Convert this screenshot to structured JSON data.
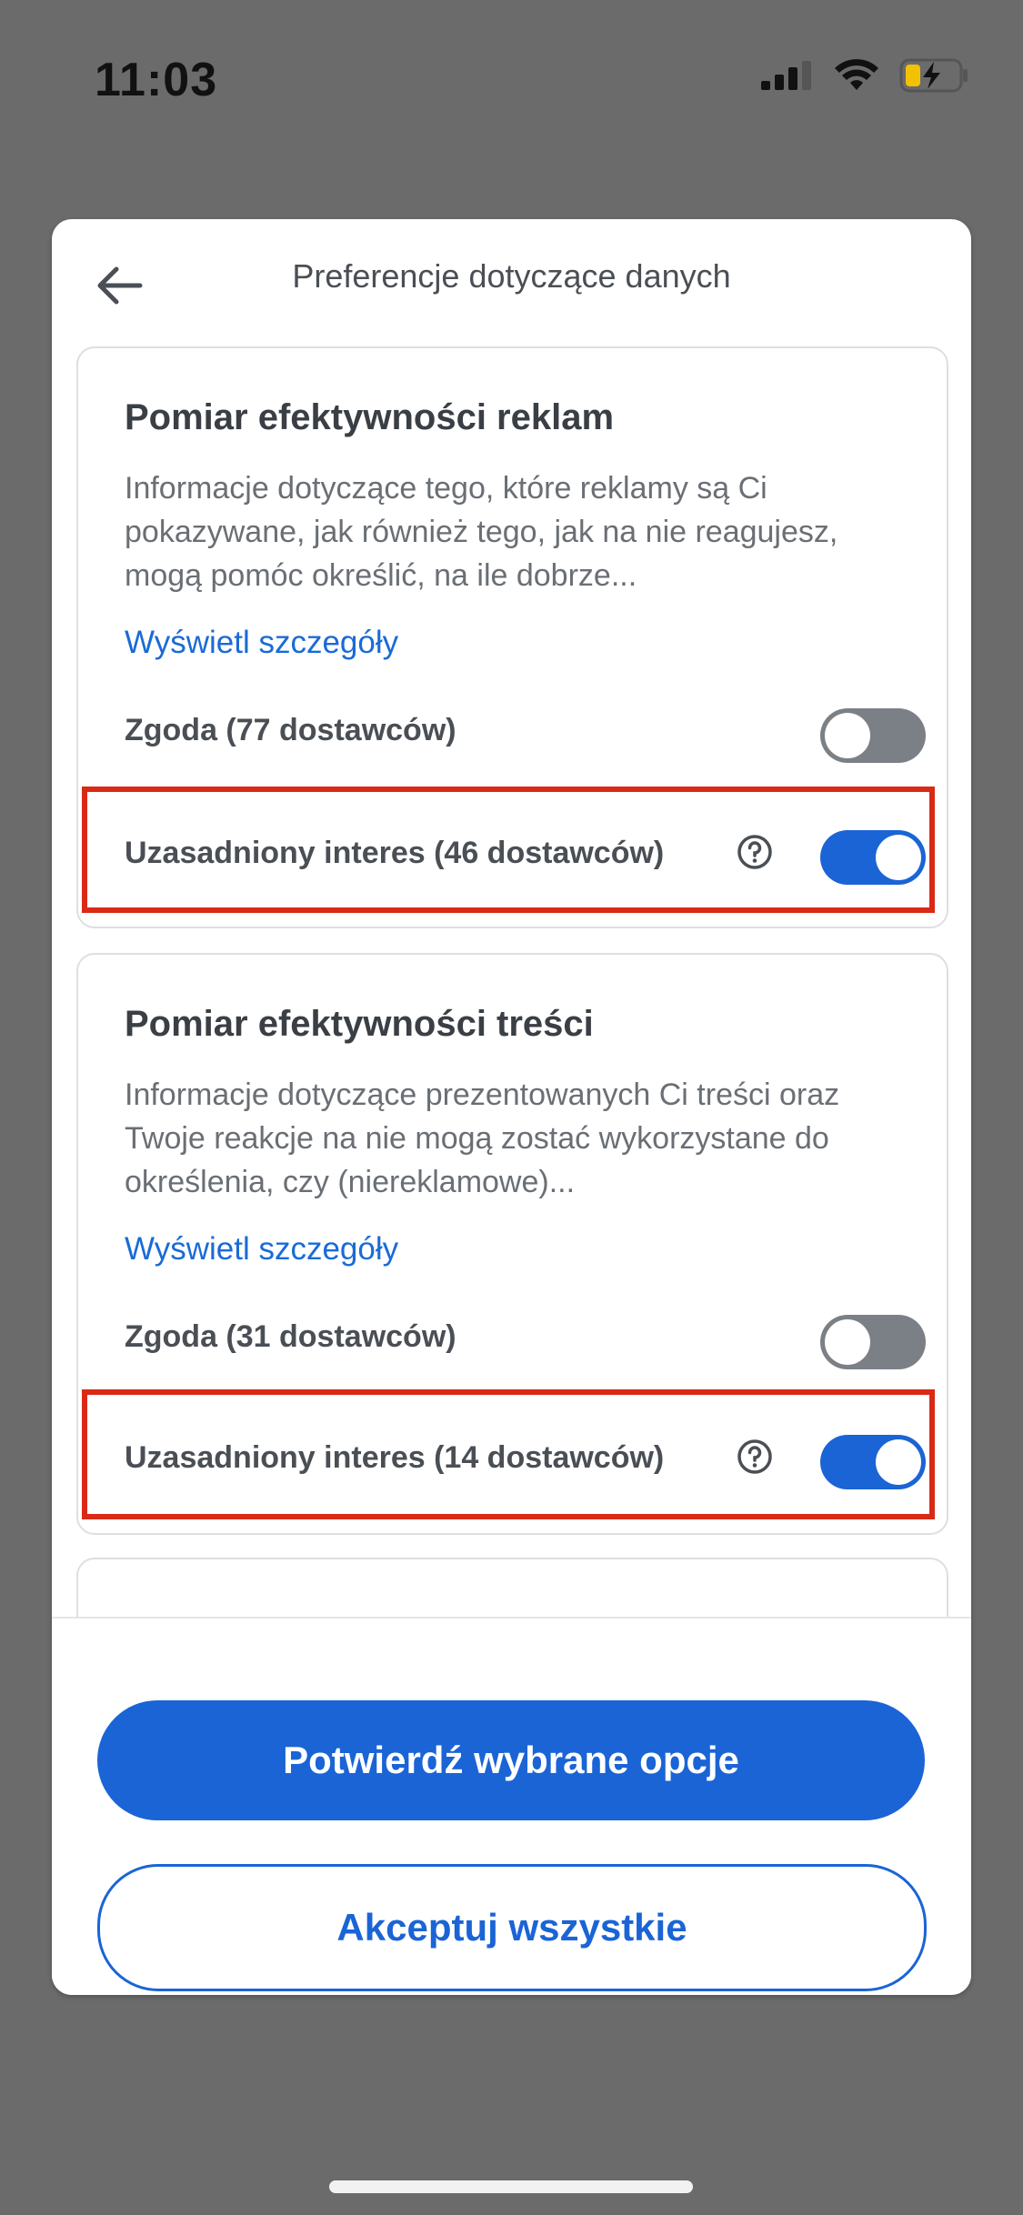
{
  "status_bar": {
    "time": "11:03",
    "icons": [
      "signal-icon",
      "wifi-icon",
      "battery-charging-icon"
    ]
  },
  "dialog": {
    "title": "Preferencje dotyczące danych",
    "back_icon": "arrow-left-icon",
    "cards": [
      {
        "title": "Pomiar efektywności reklam",
        "description": "Informacje dotyczące tego, które reklamy są Ci pokazywane, jak również tego, jak na nie reagujesz, mogą pomóc określić, na ile dobrze...",
        "details_link": "Wyświetl szczegóły",
        "consent_label": "Zgoda (77 dostawców)",
        "consent_on": false,
        "legit_label": "Uzasadniony interes (46 dostawców)",
        "legit_on": true
      },
      {
        "title": "Pomiar efektywności treści",
        "description": "Informacje dotyczące prezentowanych Ci treści oraz Twoje reakcje na nie mogą zostać wykorzystane do określenia, czy (niereklamowe)...",
        "details_link": "Wyświetl szczegóły",
        "consent_label": "Zgoda (31 dostawców)",
        "consent_on": false,
        "legit_label": "Uzasadniony interes (14 dostawców)",
        "legit_on": true
      }
    ],
    "confirm_button": "Potwierdź wybrane opcje",
    "accept_all_button": "Akceptuj wszystkie"
  },
  "colors": {
    "accent": "#1a64d6",
    "highlight": "#d92a16",
    "backdrop": "#6b6b6b"
  }
}
